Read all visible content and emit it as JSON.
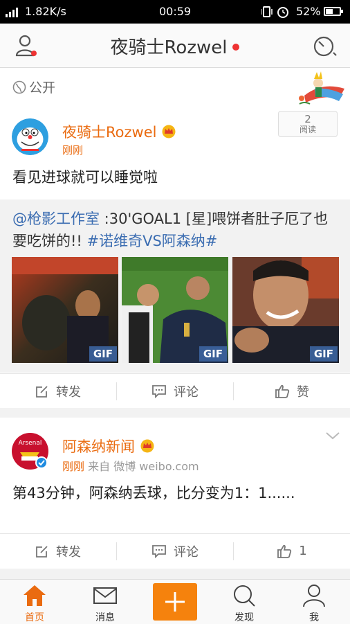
{
  "status_bar": {
    "network_speed": "1.82K/s",
    "time": "00:59",
    "battery_percent": "52%",
    "battery_level": 0.52
  },
  "header": {
    "title": "夜骑士Rozwel"
  },
  "privacy": {
    "label": "公开"
  },
  "post1": {
    "author": "夜骑士Rozwel",
    "time": "刚刚",
    "read_count": "2",
    "read_label": "阅读",
    "text": "看见进球就可以睡觉啦",
    "repost": {
      "mention": "@枪影工作室",
      "body": " :30'GOAL1 [星]喂饼者肚子厄了也要吃饼的!! ",
      "hashtag": "#诺维奇VS阿森纳#",
      "images": [
        {
          "badge": "GIF"
        },
        {
          "badge": "GIF"
        },
        {
          "badge": "GIF"
        }
      ]
    },
    "actions": {
      "forward": "转发",
      "comment": "评论",
      "like": "赞"
    }
  },
  "post2": {
    "author": "阿森纳新闻",
    "time": "刚刚",
    "source": "来自 微博 weibo.com",
    "text": "第43分钟，阿森纳丢球，比分变为1：1......",
    "avatar_text": "Arsenal",
    "actions": {
      "forward": "转发",
      "comment": "评论",
      "like": "1"
    }
  },
  "tabbar": {
    "home": "首页",
    "messages": "消息",
    "discover": "发现",
    "me": "我"
  },
  "colors": {
    "accent": "#ea6b10",
    "link": "#3a6cb1",
    "compose": "#f5820d"
  }
}
